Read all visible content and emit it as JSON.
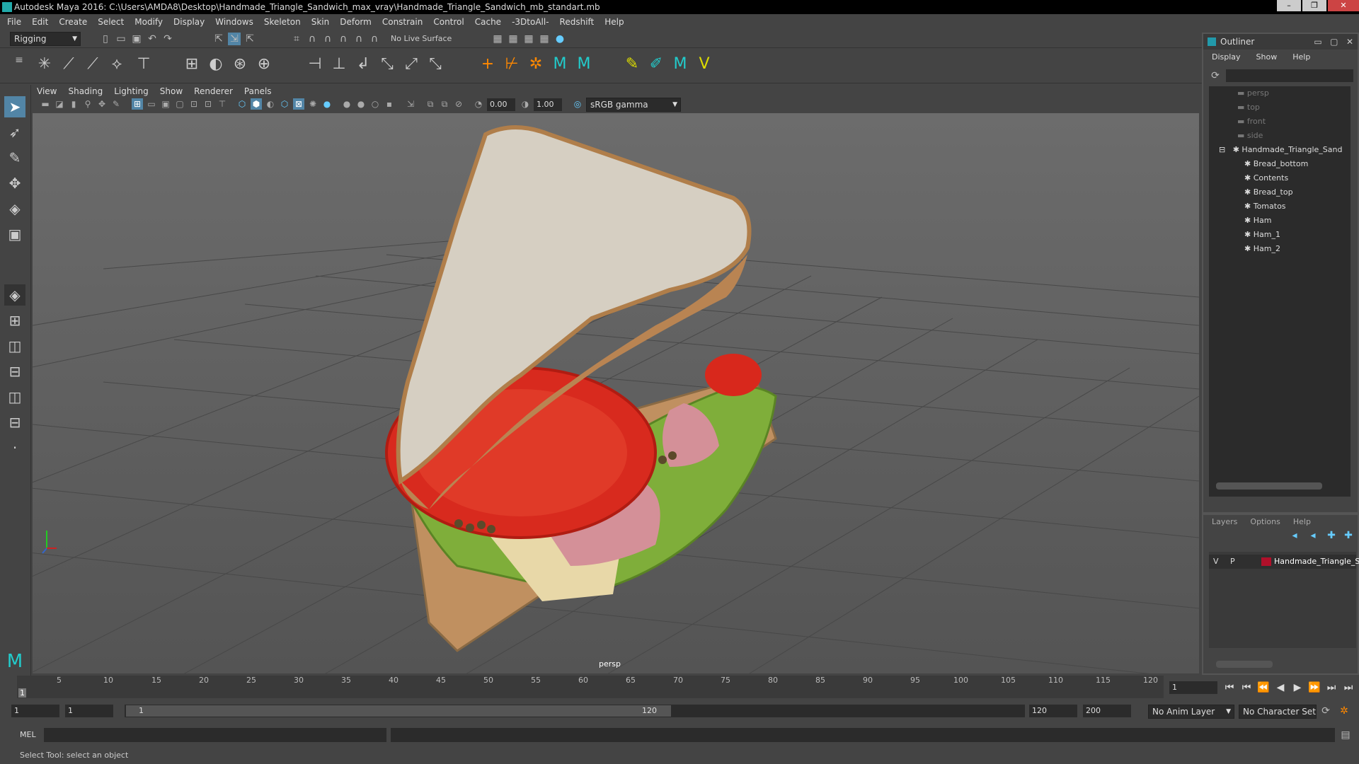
{
  "window": {
    "title": "Autodesk Maya 2016: C:\\Users\\AMDA8\\Desktop\\Handmade_Triangle_Sandwich_max_vray\\Handmade_Triangle_Sandwich_mb_standart.mb",
    "controls": [
      "–",
      "❐",
      "✕"
    ]
  },
  "menubar": [
    "File",
    "Edit",
    "Create",
    "Select",
    "Modify",
    "Display",
    "Windows",
    "Skeleton",
    "Skin",
    "Deform",
    "Constrain",
    "Control",
    "Cache",
    "-3DtoAll-",
    "Redshift",
    "Help"
  ],
  "statusline": {
    "menuset": "Rigging",
    "live_surface": "No Live Surface"
  },
  "viewport": {
    "menus": [
      "View",
      "Shading",
      "Lighting",
      "Show",
      "Renderer",
      "Panels"
    ],
    "exposure": "0.00",
    "gamma": "1.00",
    "colorspace": "sRGB gamma",
    "camera_label": "persp"
  },
  "outliner": {
    "title": "Outliner",
    "menus": [
      "Display",
      "Show",
      "Help"
    ],
    "items": [
      {
        "label": "persp",
        "dim": true,
        "indent": 0
      },
      {
        "label": "top",
        "dim": true,
        "indent": 0
      },
      {
        "label": "front",
        "dim": true,
        "indent": 0
      },
      {
        "label": "side",
        "dim": true,
        "indent": 0
      },
      {
        "label": "Handmade_Triangle_Sand",
        "dim": false,
        "indent": 0
      },
      {
        "label": "Bread_bottom",
        "dim": false,
        "indent": 1
      },
      {
        "label": "Contents",
        "dim": false,
        "indent": 1
      },
      {
        "label": "Bread_top",
        "dim": false,
        "indent": 1
      },
      {
        "label": "Tomatos",
        "dim": false,
        "indent": 1
      },
      {
        "label": "Ham",
        "dim": false,
        "indent": 1
      },
      {
        "label": "Ham_1",
        "dim": false,
        "indent": 1
      },
      {
        "label": "Ham_2",
        "dim": false,
        "indent": 1
      }
    ]
  },
  "layers": {
    "menus": [
      "Layers",
      "Options",
      "Help"
    ],
    "row": {
      "v": "V",
      "p": "P",
      "name": "Handmade_Triangle_Sa",
      "color": "#b0102a"
    }
  },
  "timeline": {
    "ticks": [
      "5",
      "10",
      "15",
      "20",
      "25",
      "30",
      "35",
      "40",
      "45",
      "50",
      "55",
      "60",
      "65",
      "70",
      "75",
      "80",
      "85",
      "90",
      "95",
      "100",
      "105",
      "110",
      "115",
      "120"
    ],
    "start_marker": "1",
    "current_frame": "1"
  },
  "range": {
    "start": "1",
    "playback_start": "1",
    "slider_start": "1",
    "slider_end": "120",
    "playback_end": "120",
    "end": "200",
    "anim_layer": "No Anim Layer",
    "character_set": "No Character Set"
  },
  "cmdline": {
    "label": "MEL"
  },
  "helpline": {
    "text": "Select Tool: select an object"
  }
}
